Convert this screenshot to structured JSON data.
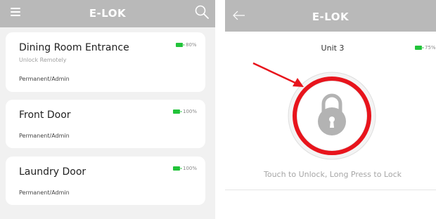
{
  "left": {
    "header": {
      "title": "E-LOK",
      "menu_icon": "hamburger-menu-icon",
      "search_icon": "search-icon"
    },
    "locks": [
      {
        "name": "Dining Room Entrance",
        "subtitle": "Unlock Remotely",
        "access": "Permanent/Admin",
        "battery": "80%"
      },
      {
        "name": "Front Door",
        "subtitle": "",
        "access": "Permanent/Admin",
        "battery": "100%"
      },
      {
        "name": "Laundry Door",
        "subtitle": "",
        "access": "Permanent/Admin",
        "battery": "100%"
      }
    ]
  },
  "right": {
    "header": {
      "title": "E-LOK",
      "back_icon": "back-arrow-icon"
    },
    "unit": {
      "title": "Unit 3",
      "battery": "75%"
    },
    "lock_button": {
      "icon": "padlock-icon",
      "state": "locked"
    },
    "hint": "Touch to Unlock, Long Press to Lock"
  },
  "annotation": {
    "highlight_color": "#e8141c",
    "arrow_color": "#e8141c"
  },
  "colors": {
    "header_bg": "#b9b9b9",
    "battery_green": "#22c33a",
    "page_bg": "#f1f1f1"
  }
}
